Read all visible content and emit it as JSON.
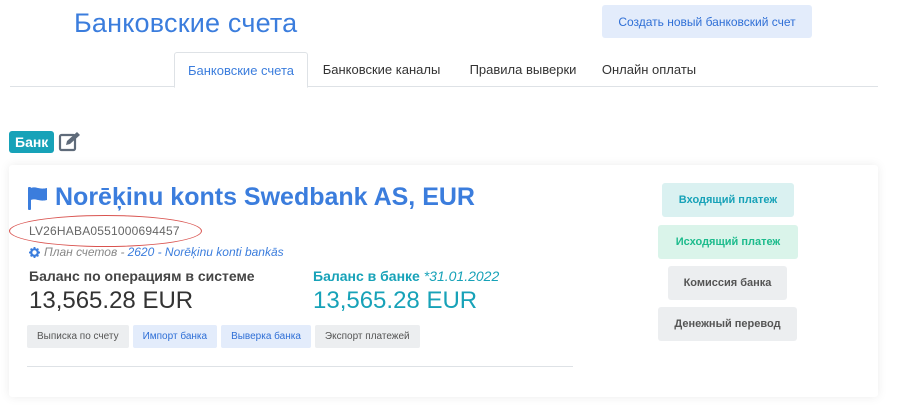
{
  "header": {
    "title": "Банковские счета",
    "create_button": "Создать новый банковский счет"
  },
  "tabs": [
    {
      "label": "Банковские счета",
      "active": true
    },
    {
      "label": "Банковские каналы",
      "active": false
    },
    {
      "label": "Правила выверки",
      "active": false
    },
    {
      "label": "Онлайн оплаты",
      "active": false
    }
  ],
  "bank_badge": "Банк",
  "account": {
    "title": "Norēķinu konts Swedbank AS, EUR",
    "iban": "LV26HABA0551000694457",
    "plan_prefix": "План счетов -",
    "plan_link": "2620 - Norēķinu konti bankās",
    "system_balance_label": "Баланс по операциям в системе",
    "system_balance": "13,565.28 EUR",
    "bank_balance_label": "Баланс в банке",
    "bank_balance_date": "*31.01.2022",
    "bank_balance": "13,565.28 EUR",
    "actions": [
      {
        "label": "Выписка по счету",
        "style": "gray"
      },
      {
        "label": "Импорт банка",
        "style": "blue"
      },
      {
        "label": "Выверка банка",
        "style": "blue"
      },
      {
        "label": "Экспорт платежей",
        "style": "gray"
      }
    ]
  },
  "side_buttons": {
    "incoming": "Входящий платеж",
    "outgoing": "Исходящий платеж",
    "fee": "Комиссия банка",
    "transfer": "Денежный перевод"
  },
  "icons": {
    "edit": "edit-icon",
    "flag": "flag-icon",
    "gear": "gear-icon"
  },
  "colors": {
    "primary": "#3b7ddd",
    "info": "#17a2b8",
    "success": "#1cbb8c",
    "highlight": "#d9534f"
  }
}
